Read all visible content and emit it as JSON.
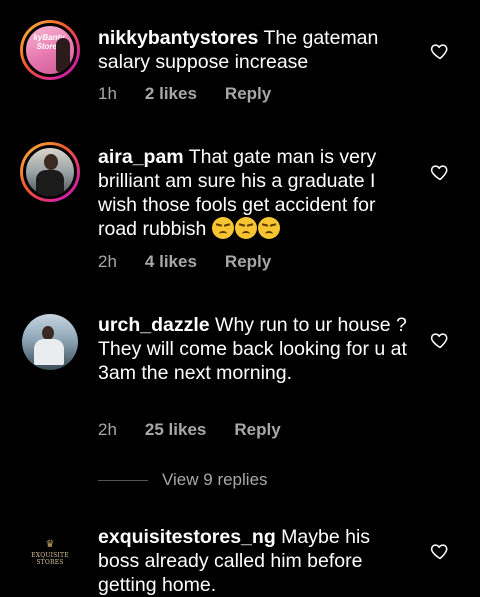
{
  "comments": [
    {
      "username": "nikkybantystores",
      "text": " The gateman salary suppose increase",
      "time": "1h",
      "likes": "2 likes",
      "reply": "Reply",
      "avatar_text": "kyBanty Stores"
    },
    {
      "username": "aira_pam",
      "text": " That gate man is very brilliant am sure his a graduate I wish those fools get accident for road rubbish ",
      "time": "2h",
      "likes": "4 likes",
      "reply": "Reply"
    },
    {
      "username": "urch_dazzle",
      "text": " Why run to ur house ? They will come back looking for u at 3am the next morning.",
      "time": "2h",
      "likes": "25 likes",
      "reply": "Reply"
    },
    {
      "username": "exquisitestores_ng",
      "text": " Maybe his boss already called him before getting home.",
      "avatar_brand": "EXQUISITE STORES"
    }
  ],
  "view_replies": "View 9 replies",
  "icons": {
    "like": "heart-outline-icon",
    "emoji": "unamused-face-icon"
  },
  "colors": {
    "background": "#000000",
    "text": "#ffffff",
    "muted": "#a8a8a8"
  }
}
